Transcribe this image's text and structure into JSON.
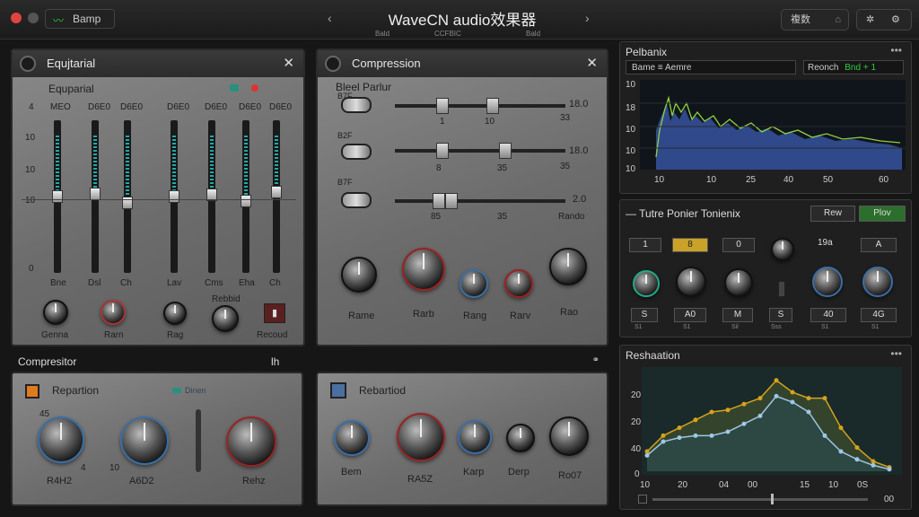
{
  "titlebar": {
    "brand": "Bamp",
    "title": "WaveCN audio效果器",
    "subtabs": [
      "Bald",
      "CCFBIC",
      "Bald"
    ],
    "btn_settings": "複数"
  },
  "equalizer": {
    "header": "Equjtarial",
    "subtitle": "Equparial",
    "col_labels": [
      "MEO",
      "D6E0",
      "D6E0",
      "D6E0",
      "D6E0",
      "D6E0",
      "D6E0"
    ],
    "db_labels": [
      "4",
      "10",
      "10",
      "10",
      "0"
    ],
    "band_labels": [
      "Bne",
      "Dsl",
      "Ch",
      "Lav",
      "Cms",
      "Eha",
      "Ch"
    ],
    "knob_labels": [
      "Genna",
      "Rarn",
      "Rag",
      "Rebbid",
      "Recoud"
    ],
    "fader_levels": [
      0.5,
      0.52,
      0.46,
      0.5,
      0.51,
      0.47,
      0.53
    ]
  },
  "compression_top": {
    "header": "Compression",
    "subtitle": "Bleel Parlur",
    "rows": [
      {
        "label": "B7F",
        "tick_a": "1",
        "tick_b": "10",
        "val": "18.0",
        "sub": "33"
      },
      {
        "label": "B2F",
        "tick_a": "8",
        "tick_b": "35",
        "val": "18.0",
        "sub": "35"
      },
      {
        "label": "B7F",
        "tick_a": "85",
        "tick_b": "35",
        "val": "2.0",
        "sub": "Rando"
      }
    ],
    "knob_labels": [
      "Rame",
      "Rarb",
      "Rang",
      "Rarv",
      "Rao"
    ]
  },
  "compressor_bottom": {
    "header": "Compresitor",
    "header_right": "lh",
    "sub_left": "Repartion",
    "sub_left_tag": "Dinen",
    "knob_labels_left": [
      "R4H2",
      "A6D2",
      "Rehz"
    ],
    "sub_right": "Rebartiod",
    "knob_labels_right": [
      "Bem",
      "RA5Z",
      "Karp",
      "Derp",
      "Ro07"
    ],
    "knob_ticks": [
      "45",
      "10",
      "4"
    ]
  },
  "spectrum": {
    "header": "Pelbanix",
    "field1": "Bame ≡ Aemre",
    "field2_label": "Reonch",
    "field2_value": "Bnd + 1",
    "y_labels": [
      "10",
      "18",
      "10",
      "10",
      "10"
    ],
    "x_labels": [
      "10",
      "10",
      "25",
      "40",
      "50",
      "60"
    ]
  },
  "tone": {
    "header": "Tutre Ponier Tonienix",
    "btn_raw": "Rew",
    "btn_play": "Plov",
    "top_values": [
      "1",
      "8",
      "0",
      "19a",
      "A"
    ],
    "bottom_labels": [
      "S",
      "A0",
      "M",
      "S",
      "40",
      "4G"
    ],
    "tiny": [
      "S1",
      "S1",
      "Sil",
      "Sss",
      "S1",
      "S1"
    ]
  },
  "curve": {
    "header": "Reshaation",
    "y_labels": [
      "20",
      "20",
      "40",
      "0"
    ],
    "x_labels": [
      "10",
      "20",
      "04",
      "00",
      "15",
      "10",
      "0S"
    ],
    "corner": "00"
  },
  "chart_data": {
    "type": "line",
    "series": [
      {
        "values": [
          10,
          18,
          22,
          26,
          30,
          31,
          34,
          37,
          46,
          40,
          37,
          37,
          22,
          12,
          5,
          2
        ]
      },
      {
        "values": [
          8,
          15,
          17,
          18,
          18,
          20,
          24,
          28,
          38,
          35,
          30,
          18,
          10,
          6,
          3,
          1
        ]
      }
    ],
    "colors": [
      "#d6a21e",
      "#9ec6e8"
    ]
  }
}
